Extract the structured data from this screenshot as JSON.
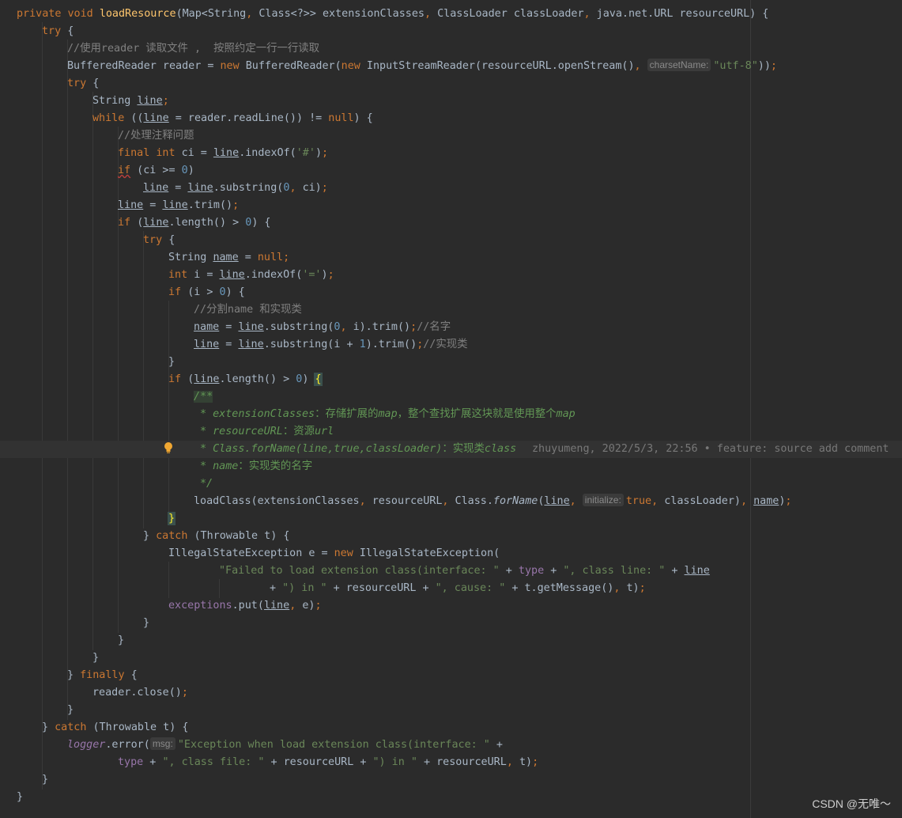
{
  "editor": {
    "lines": [
      "private void loadResource(Map<String, Class<?>> extensionClasses, ClassLoader classLoader, java.net.URL resourceURL) {",
      "try {",
      "//使用reader 读取文件 ,  按照约定一行一行读取",
      "BufferedReader reader = new BufferedReader(new InputStreamReader(resourceURL.openStream(), \"utf-8\"));",
      "try {",
      "String line;",
      "while ((line = reader.readLine()) != null) {",
      "//处理注释问题",
      "final int ci = line.indexOf('#');",
      "if (ci >= 0)",
      "line = line.substring(0, ci);",
      "line = line.trim();",
      "if (line.length() > 0) {",
      "try {",
      "String name = null;",
      "int i = line.indexOf('=');",
      "if (i > 0) {",
      "//分割name 和实现类",
      "name = line.substring(0, i).trim();//名字",
      "line = line.substring(i + 1).trim();//实现类",
      "}",
      "if (line.length() > 0) {",
      "/**",
      "* extensionClasses：存储扩展的map，整个查找扩展这块就是使用整个map",
      "* resourceURL：资源url",
      "* Class.forName(line,true,classLoader)：实现类class",
      "* name：实现类的名字",
      "*/",
      "loadClass(extensionClasses, resourceURL, Class.forName(line, true, classLoader), name);",
      "}",
      "} catch (Throwable t) {",
      "IllegalStateException e = new IllegalStateException(",
      "\"Failed to load extension class(interface: \" + type + \", class line: \" + line",
      "+ \") in \" + resourceURL + \", cause: \" + t.getMessage(), t);",
      "exceptions.put(line, e);",
      "}",
      "}",
      "}",
      "} finally {",
      "reader.close();",
      "}",
      "} catch (Throwable t) {",
      "logger.error(\"Exception when load extension class(interface: \" +",
      "type + \", class file: \" + resourceURL + \") in \" + resourceURL, t);",
      "}",
      "}"
    ],
    "hints": {
      "charset": "charsetName:",
      "initialize": "initialize:",
      "msg": "msg:"
    },
    "blame": "zhuyumeng, 2022/5/3, 22:56 • feature: source add comment",
    "colors": {
      "background": "#2b2b2b",
      "keyword": "#cc7832",
      "method_decl": "#ffc66d",
      "string": "#6a8759",
      "number": "#6897bb",
      "comment": "#808080",
      "javadoc": "#629755",
      "field": "#9876aa",
      "text": "#a9b7c6"
    }
  },
  "watermark": "CSDN @无唯～"
}
